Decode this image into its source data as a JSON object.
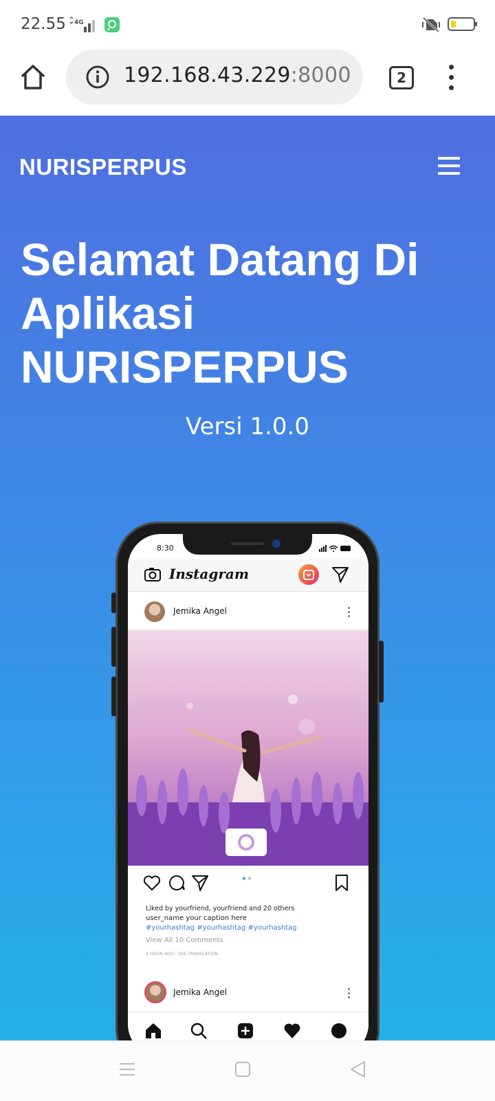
{
  "status_bar": {
    "time": "22.55",
    "network": "4G",
    "icons": [
      "signal-icon",
      "app-notification-icon",
      "vibrate-off-icon",
      "battery-low-icon"
    ]
  },
  "browser": {
    "url_host": "192.168.43.229",
    "url_port": ":8000",
    "tab_count": "2",
    "icons": [
      "home-icon",
      "info-icon",
      "tab-switcher-icon",
      "overflow-menu-icon"
    ]
  },
  "page": {
    "brand": "NURISPERPUS",
    "headline_bold": "Selamat Datang",
    "headline_rest": " Di Aplikasi NURISPERPUS",
    "version": "Versi 1.0.0"
  },
  "mockup": {
    "time": "8:30",
    "app_logo": "Instagram",
    "post_user": "Jemika Angel",
    "liked_by": "Liked by yourfriend, yourfriend and 20 others",
    "caption": "user_name  your caption here",
    "hashtags": "#yourhashtag #yourhashtag #yourhashtag",
    "view_comments": "View All 10 Comments",
    "meta": "2 HOUR AGO  · SEE TRANSLATION",
    "second_user": "Jemika Angel"
  },
  "colors": {
    "gradient_top": "#4f6fe0",
    "gradient_bottom": "#25b1e8",
    "hashtag": "#3a7bd5"
  },
  "android_nav": [
    "recents-icon",
    "home-square-icon",
    "back-icon"
  ]
}
